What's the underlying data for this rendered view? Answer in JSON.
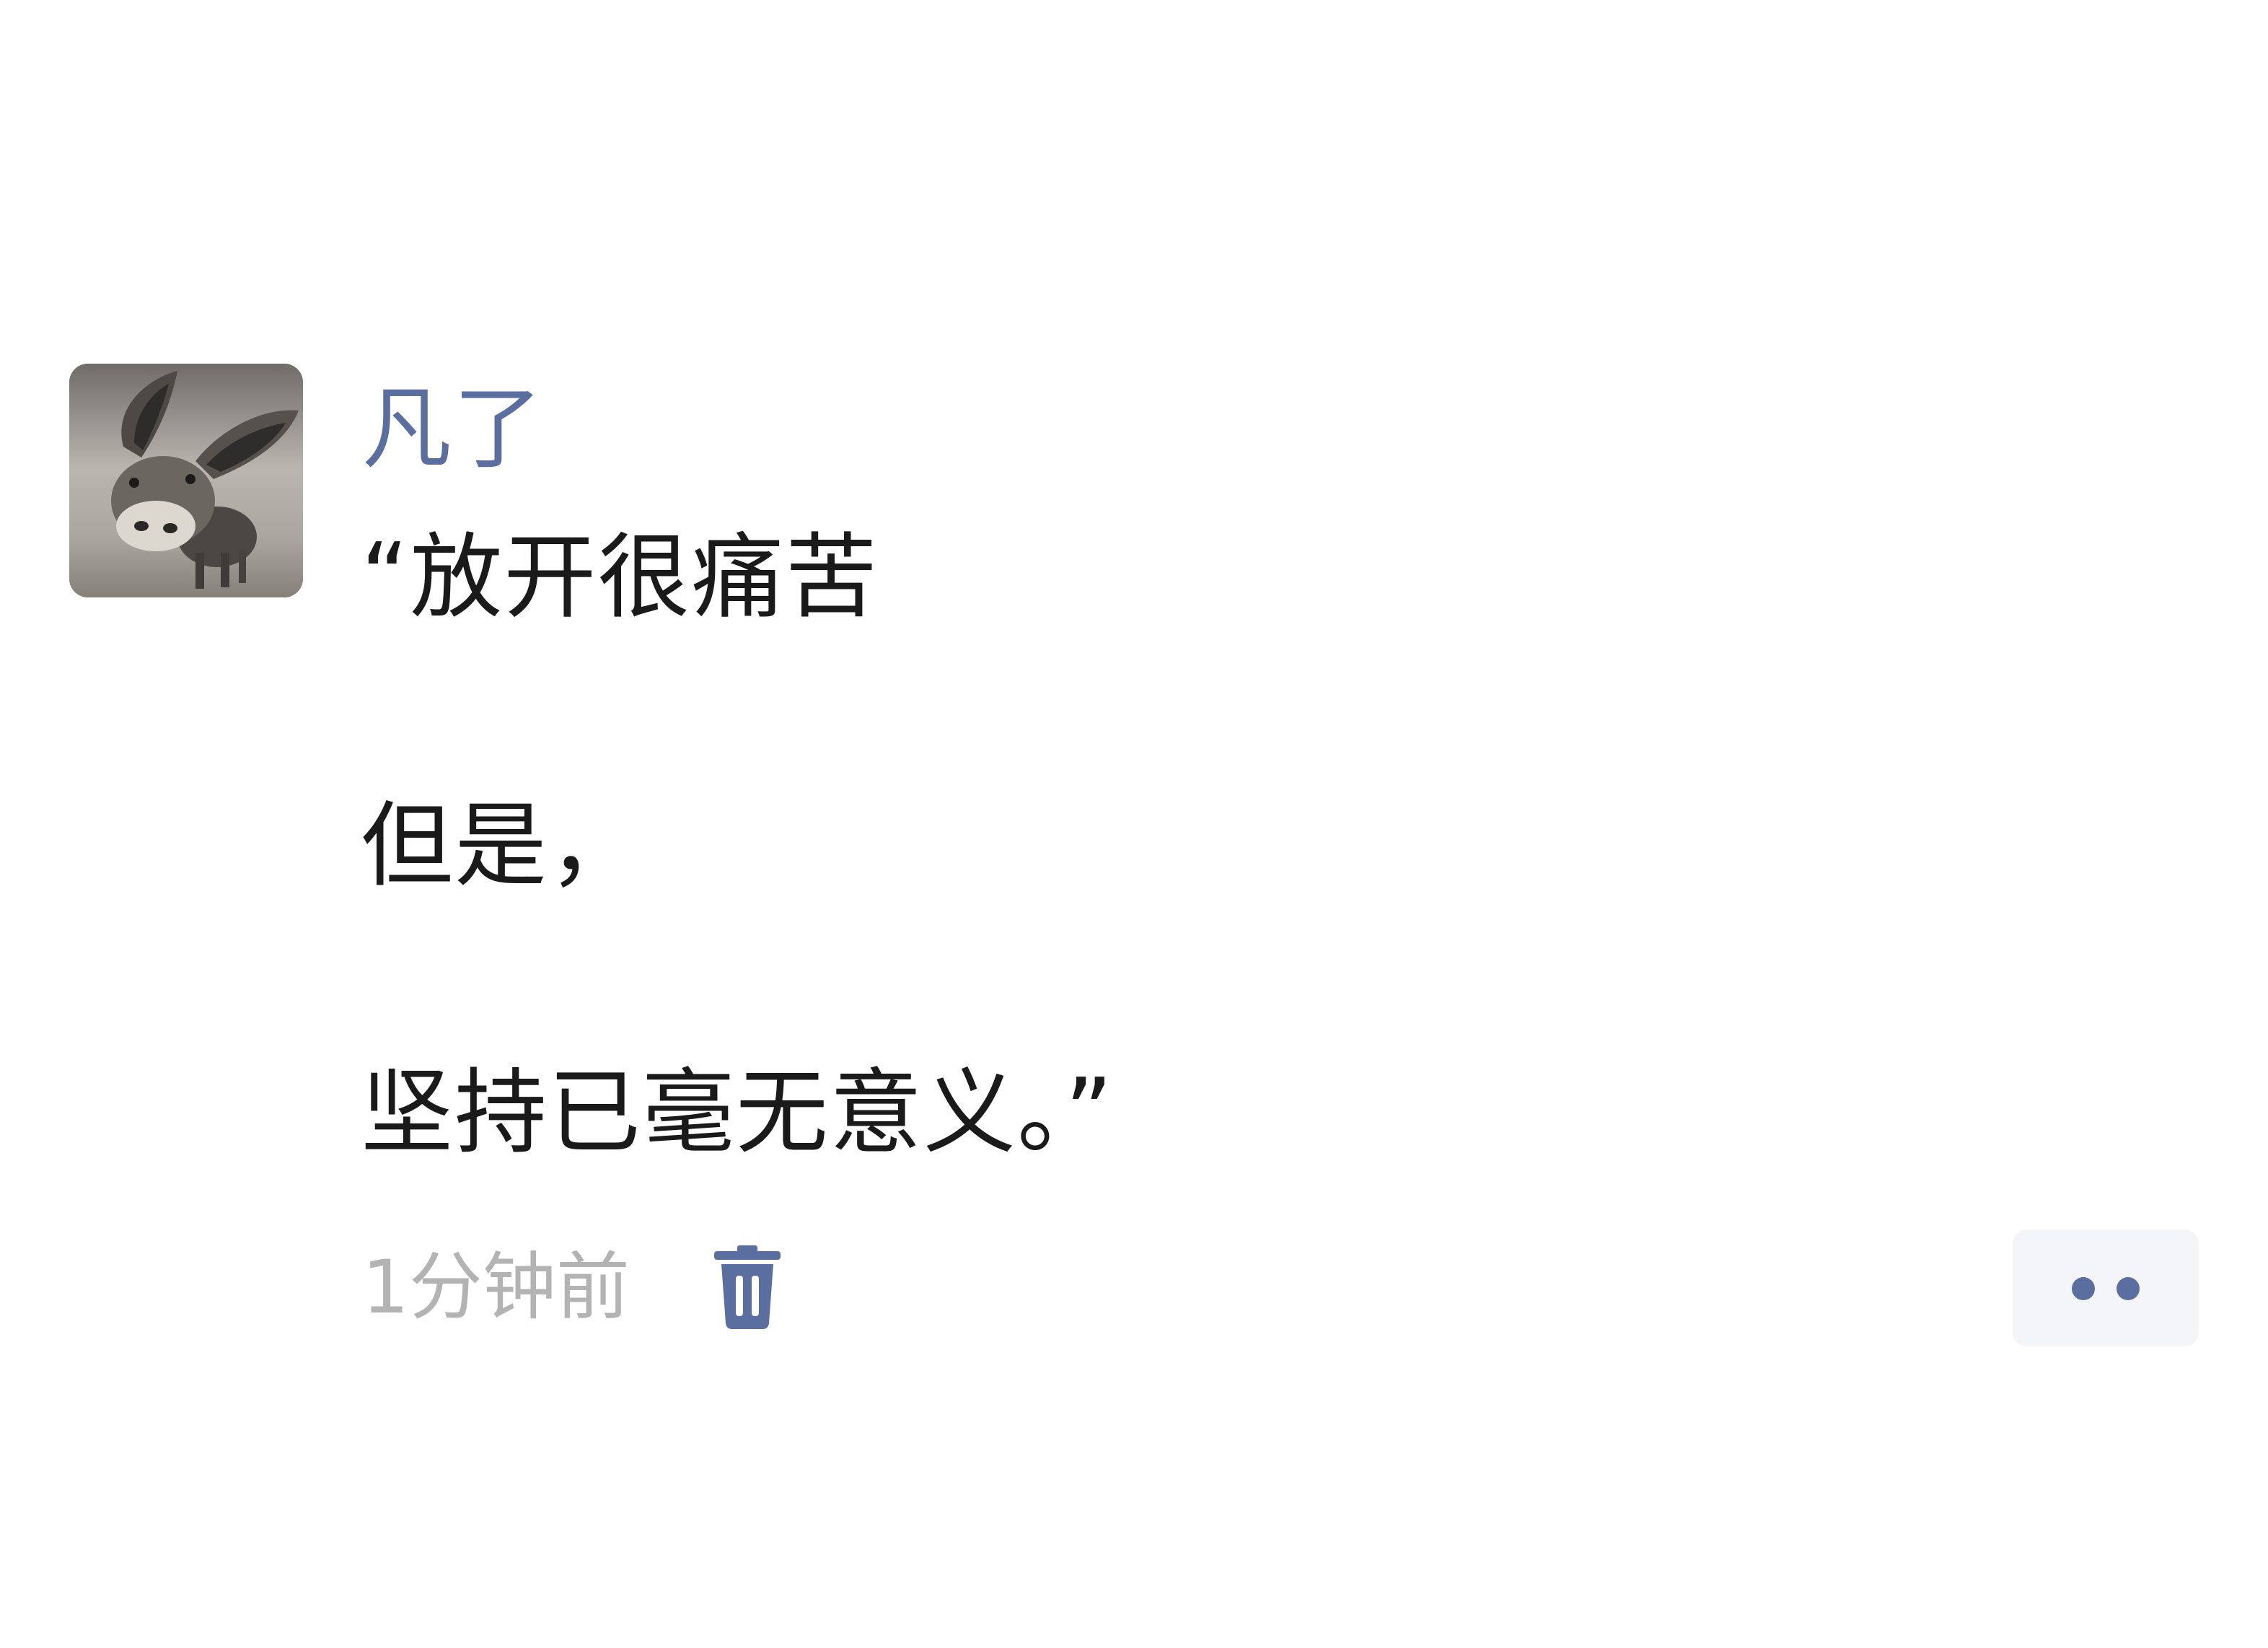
{
  "author": {
    "name": "凡了",
    "avatar_icon": "donkey-photo-avatar"
  },
  "post": {
    "lines": [
      "“放开很痛苦",
      "但是，",
      "坚持已毫无意义。”"
    ],
    "timestamp": "1分钟前"
  },
  "actions": {
    "delete_icon": "trash-icon",
    "more_icon": "more-dots-icon"
  },
  "colors": {
    "author_name": "#5a6fa0",
    "body_text": "#1a1a1a",
    "timestamp": "#b3b3b3",
    "accent_icon": "#5a6fa0",
    "more_button_bg": "#f4f5f8"
  }
}
